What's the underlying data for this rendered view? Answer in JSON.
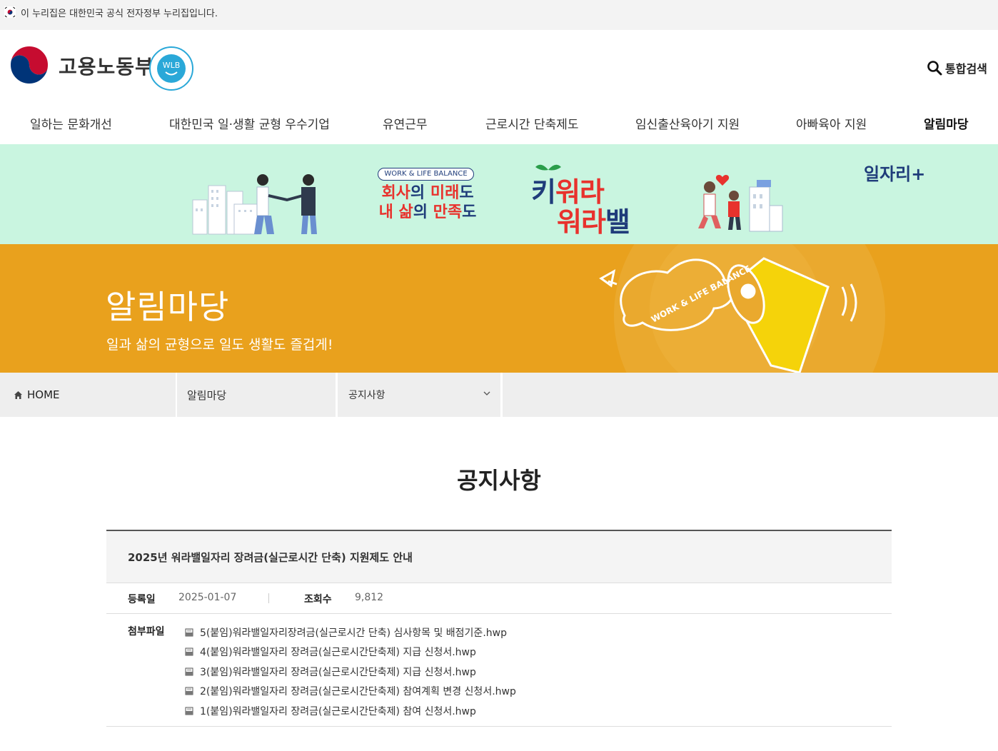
{
  "gov_notice": {
    "text": "이 누리집은 대한민국 공식 전자정부 누리집입니다.",
    "flag_icon": "korea-flag-icon"
  },
  "header": {
    "logo_text": "고용노동부",
    "badge_text": "WLB",
    "search_label": "통합검색",
    "search_icon": "search-icon"
  },
  "gnb": {
    "items": [
      {
        "label": "일하는 문화개선"
      },
      {
        "label": "대한민국 일·생활 균형 우수기업"
      },
      {
        "label": "유연근무"
      },
      {
        "label": "근로시간 단축제도"
      },
      {
        "label": "임신출산육아기 지원"
      },
      {
        "label": "아빠육아 지원"
      },
      {
        "label": "알림마당",
        "active": true
      }
    ]
  },
  "banner": {
    "pill": "WORK & LIFE BALANCE",
    "slogan_line1_a": "회사",
    "slogan_line1_b": "의 ",
    "slogan_line1_c": "미래",
    "slogan_line1_d": "도",
    "slogan_line2_a": "내 삶",
    "slogan_line2_b": "의 ",
    "slogan_line2_c": "만족",
    "slogan_line2_d": "도",
    "brand1_a": "키",
    "brand1_b": "워라",
    "brand2_a": "워라",
    "brand2_b": "밸",
    "jobs_logo": "일자리+"
  },
  "hero": {
    "title": "알림마당",
    "subtitle": "일과 삶의 균형으로 일도 생활도 즐겁게!",
    "megaphone_text": "WORK & LIFE BALANCE"
  },
  "location": {
    "home": "HOME",
    "level1": "알림마당",
    "level2": "공지사항"
  },
  "page_title": "공지사항",
  "post": {
    "subject": "2025년 워라밸일자리 장려금(실근로시간 단축) 지원제도 안내",
    "date_label": "등록일",
    "date": "2025-01-07",
    "views_label": "조회수",
    "views": "9,812",
    "files_label": "첨부파일",
    "files": [
      "5(붙임)워라밸일자리장려금(실근로시간 단축) 심사항목 및 배점기준.hwp",
      "4(붙임)워라밸일자리 장려금(실근로시간단축제) 지급 신청서.hwp",
      "3(붙임)워라밸일자리 장려금(실근로시간단축제) 지급 신청서.hwp",
      "2(붙임)워라밸일자리 장려금(실근로시간단축제) 참여계획 변경 신청서.hwp",
      "1(붙임)워라밸일자리 장려금(실근로시간단축제) 참여 신청서.hwp"
    ]
  },
  "colors": {
    "banner_green": "#c9f5e0",
    "hero_orange": "#e9a11d",
    "navy": "#1f3c7a",
    "red": "#e8322d"
  }
}
